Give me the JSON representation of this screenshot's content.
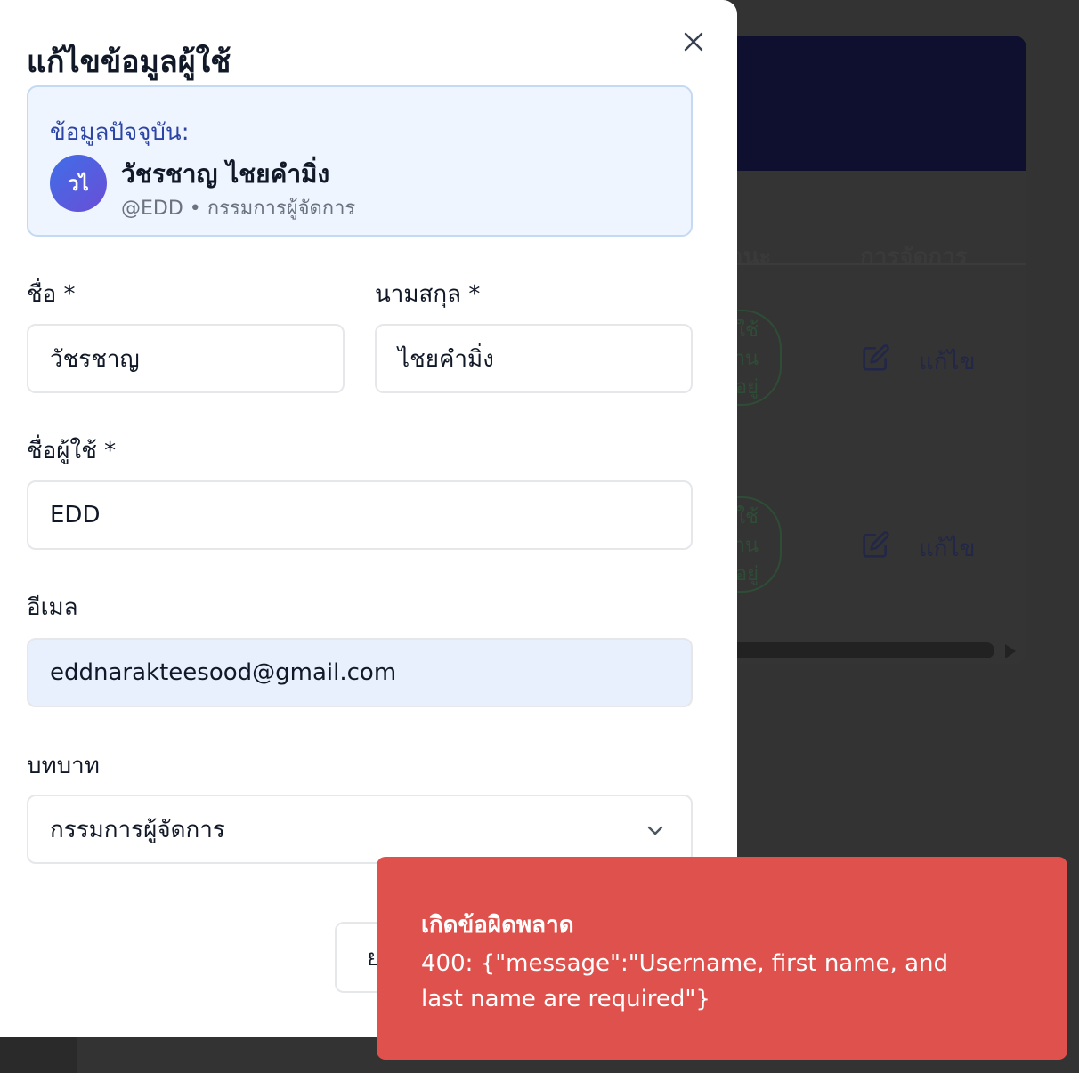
{
  "background": {
    "table_headers": {
      "status": "านะ",
      "actions": "การจัดการ"
    },
    "rows": [
      {
        "badge": "ใช้\nาน\nอยู่",
        "action_label": "แก้ไข"
      },
      {
        "badge": "ใช้\nาน\nอยู่",
        "action_label": "แก้ไข"
      }
    ]
  },
  "modal": {
    "title": "แก้ไขข้อมูลผู้ใช้",
    "close_icon": "close-icon",
    "current": {
      "label": "ข้อมูลปัจจุบัน:",
      "avatar_initials": "วไ",
      "name": "วัชรชาญ ไชยคำมิ่ง",
      "meta": "@EDD • กรรมการผู้จัดการ"
    },
    "fields": {
      "first_name": {
        "label": "ชื่อ *",
        "value": "วัชรชาญ"
      },
      "last_name": {
        "label": "นามสกุล *",
        "value": "ไชยคำมิ่ง"
      },
      "username": {
        "label": "ชื่อผู้ใช้ *",
        "value": "EDD"
      },
      "email": {
        "label": "อีเมล",
        "value": "eddnarakteesood@gmail.com"
      },
      "role": {
        "label": "บทบาท",
        "value": "กรรมการผู้จัดการ"
      }
    },
    "cancel_label": "ยกเลิก"
  },
  "toast": {
    "title": "เกิดข้อผิดพลาด",
    "message": "400: {\"message\":\"Username, first name, and last name are required\"}",
    "color": "#de514c"
  },
  "colors": {
    "overlay": "#333333",
    "accent_blue": "#2c44a3",
    "header_dark": "#0f0f30"
  }
}
